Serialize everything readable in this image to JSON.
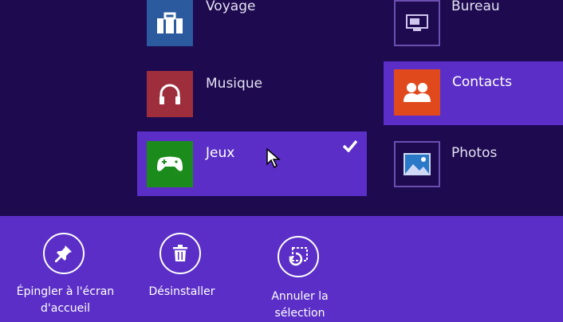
{
  "apps": [
    {
      "label": "Voyage",
      "icon": "suitcase-icon",
      "color": "#2b5a9e"
    },
    {
      "label": "Bureau",
      "icon": "desktop-icon",
      "color": "#1d0a4f"
    },
    {
      "label": "Musique",
      "icon": "headphones-icon",
      "color": "#9e2e3b"
    },
    {
      "label": "Contacts",
      "icon": "people-icon",
      "color": "#e0491c",
      "highlighted": true
    },
    {
      "label": "Jeux",
      "icon": "game-controller-icon",
      "color": "#1b8b1c",
      "selected": true
    },
    {
      "label": "Photos",
      "icon": "picture-icon",
      "color": "#1a6cb0"
    }
  ],
  "app_bar": {
    "commands": [
      {
        "label_line1": "Épingler à l'écran",
        "label_line2": "d'accueil",
        "icon": "pin-icon"
      },
      {
        "label_line1": "Désinstaller",
        "label_line2": "",
        "icon": "trash-icon"
      },
      {
        "label_line1": "Annuler la",
        "label_line2": "sélection",
        "icon": "clear-selection-icon"
      }
    ]
  },
  "colors": {
    "background": "#1d0a4f",
    "accent": "#5b2fc7"
  }
}
